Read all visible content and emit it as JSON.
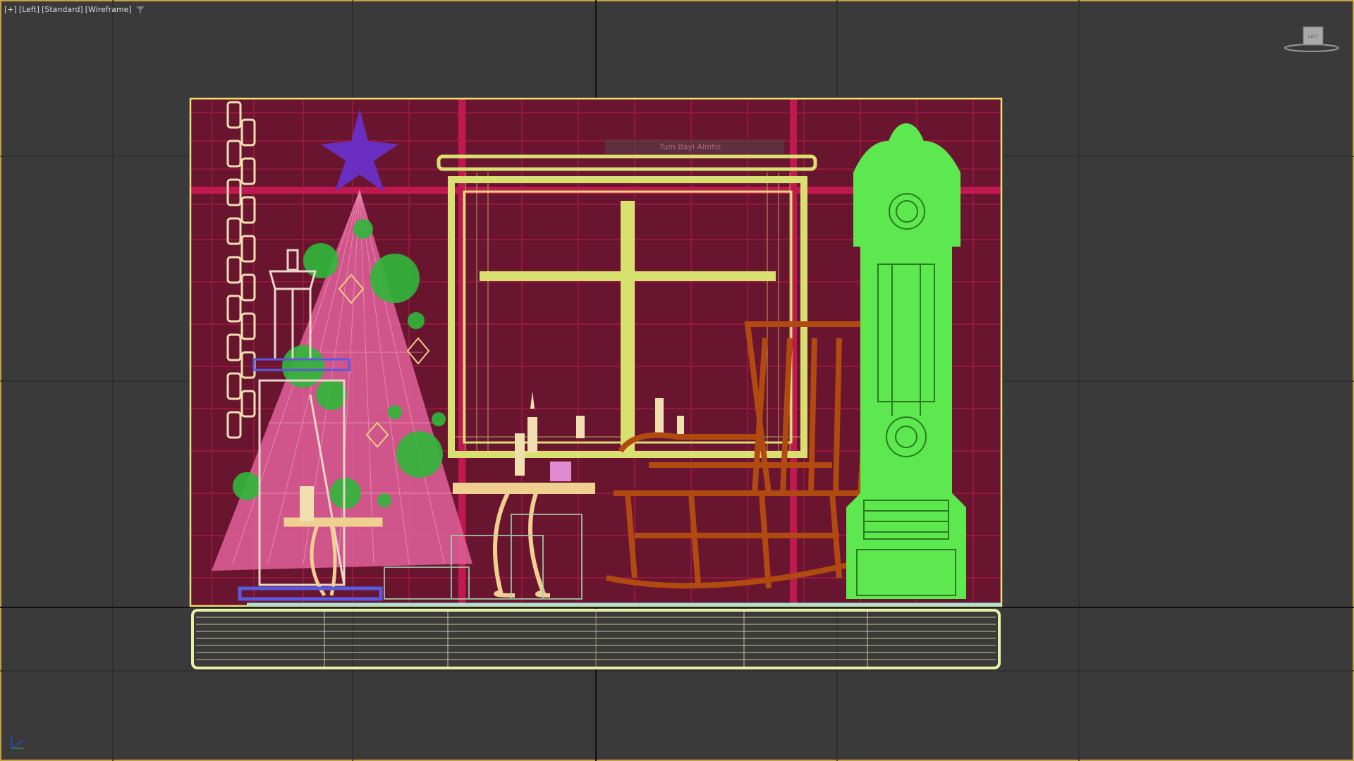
{
  "viewport": {
    "menu_label": "[+]",
    "view_label": "[Left]",
    "shading_label": "[Standard]",
    "display_label": "[Wireframe]",
    "filter_icon": "filter-icon",
    "viewcube_face_label": "LEFT",
    "frame_color": "#c8a240",
    "background_color": "#3a3a3a"
  },
  "scene": {
    "faded_label": "Tum Bayi Alintis",
    "objects": [
      {
        "name": "christmas-tree",
        "color": "#e0609a"
      },
      {
        "name": "tree-star",
        "color": "#6a2fc0"
      },
      {
        "name": "ornaments",
        "color": "#2fb83a"
      },
      {
        "name": "chain-garland",
        "color": "#f0e0b0"
      },
      {
        "name": "lantern",
        "color": "#e8d6c8"
      },
      {
        "name": "window-frame",
        "color": "#d8e070"
      },
      {
        "name": "candles",
        "color": "#f0e0b0"
      },
      {
        "name": "side-table",
        "color": "#f0d090"
      },
      {
        "name": "rocking-chair",
        "color": "#b04a10"
      },
      {
        "name": "grandfather-clock",
        "color": "#5ee850"
      },
      {
        "name": "room-walls",
        "color": "#b0184a"
      },
      {
        "name": "floor-base",
        "color": "#e8f0a8"
      }
    ]
  }
}
